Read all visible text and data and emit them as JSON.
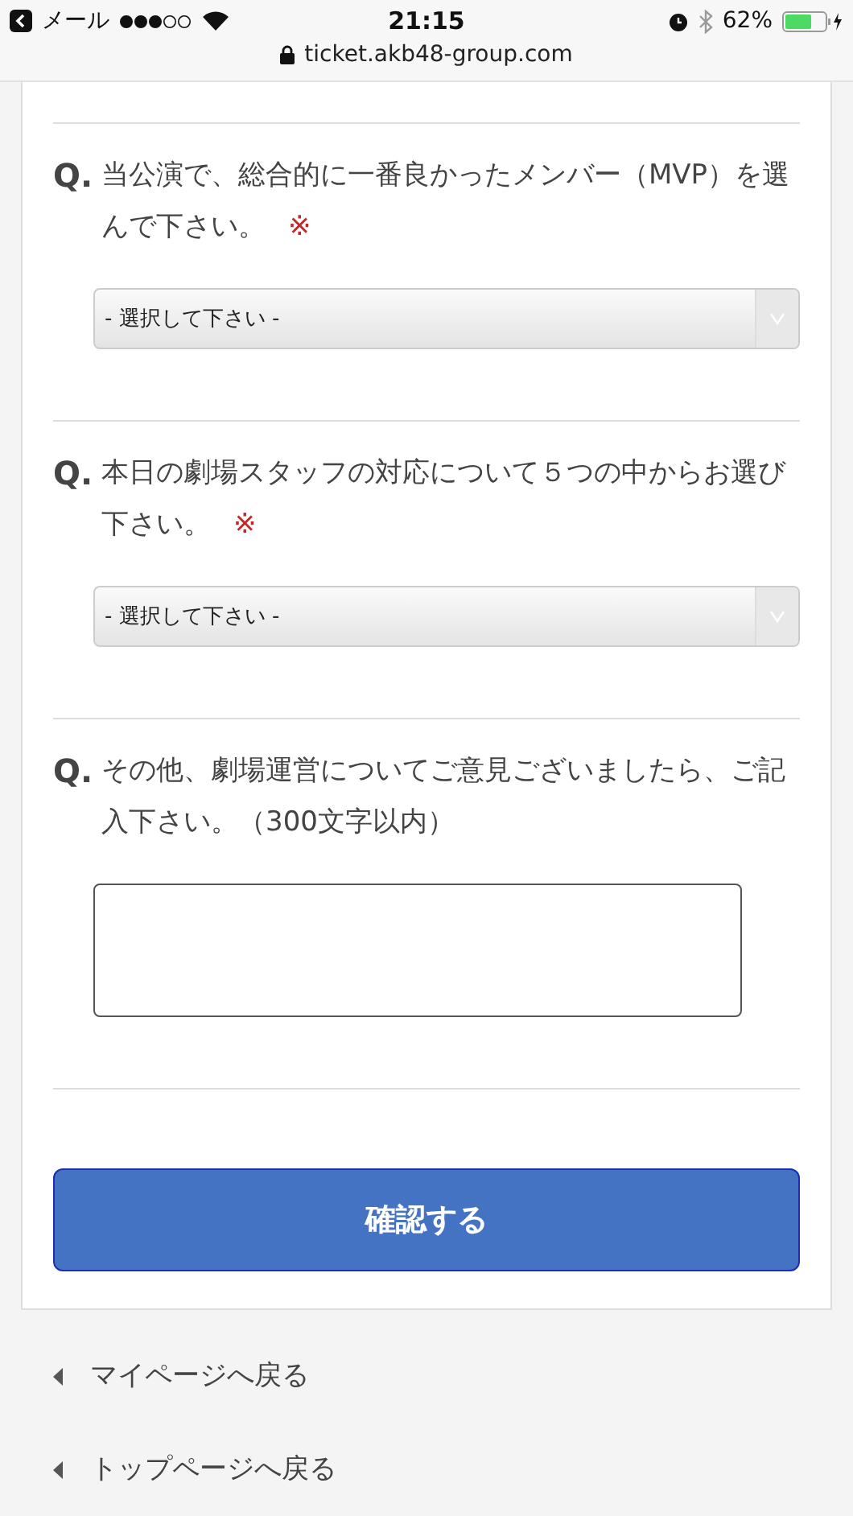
{
  "status_bar": {
    "back_label": "メール",
    "time": "21:15",
    "battery": "62%",
    "url": "ticket.akb48-group.com"
  },
  "questions": [
    {
      "kind": "select",
      "q": "Q.",
      "text": "当公演で、総合的に一番良かったメンバー（MVP）を選んで下さい。",
      "required_mark": "※",
      "value": "- 選択して下さい -"
    },
    {
      "kind": "select",
      "q": "Q.",
      "text": "本日の劇場スタッフの対応について５つの中からお選び下さい。",
      "required_mark": "※",
      "value": "- 選択して下さい -"
    },
    {
      "kind": "textarea",
      "q": "Q.",
      "text": "その他、劇場運営についてご意見ございましたら、ご記入下さい。（300文字以内）"
    }
  ],
  "submit": "確認する",
  "links": [
    "マイページへ戻る",
    "トップページへ戻る"
  ]
}
